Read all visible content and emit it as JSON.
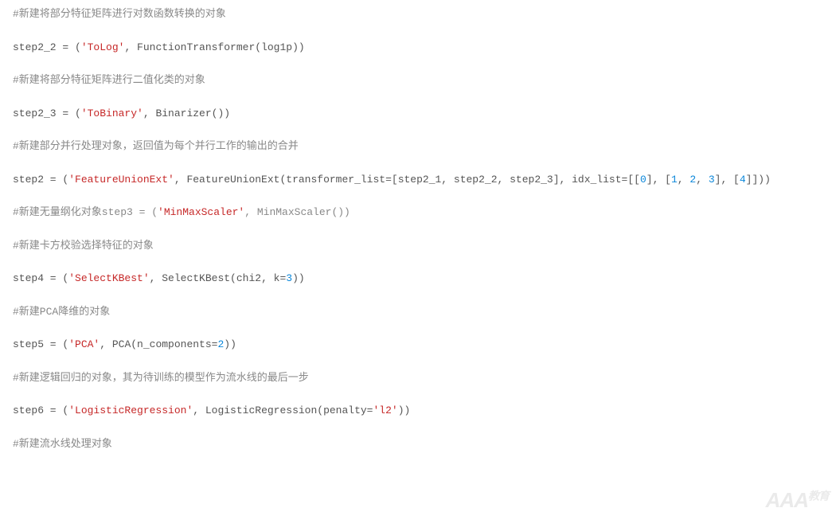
{
  "lines": [
    [
      {
        "class": "comment",
        "text": "#新建将部分特征矩阵进行对数函数转换的对象"
      }
    ],
    [
      {
        "class": "plain",
        "text": "step2_2 = ("
      },
      {
        "class": "string",
        "text": "'ToLog'"
      },
      {
        "class": "plain",
        "text": ", FunctionTransformer(log1p))"
      }
    ],
    [
      {
        "class": "comment",
        "text": "#新建将部分特征矩阵进行二值化类的对象"
      }
    ],
    [
      {
        "class": "plain",
        "text": "step2_3 = ("
      },
      {
        "class": "string",
        "text": "'ToBinary'"
      },
      {
        "class": "plain",
        "text": ", Binarizer())"
      }
    ],
    [
      {
        "class": "comment",
        "text": "#新建部分并行处理对象，返回值为每个并行工作的输出的合并"
      }
    ],
    [
      {
        "class": "plain",
        "text": "step2 = ("
      },
      {
        "class": "string",
        "text": "'FeatureUnionExt'"
      },
      {
        "class": "plain",
        "text": ", FeatureUnionExt(transformer_list=[step2_1, step2_2, step2_3], idx_list=[["
      },
      {
        "class": "number",
        "text": "0"
      },
      {
        "class": "plain",
        "text": "], ["
      },
      {
        "class": "number",
        "text": "1"
      },
      {
        "class": "plain",
        "text": ", "
      },
      {
        "class": "number",
        "text": "2"
      },
      {
        "class": "plain",
        "text": ", "
      },
      {
        "class": "number",
        "text": "3"
      },
      {
        "class": "plain",
        "text": "], ["
      },
      {
        "class": "number",
        "text": "4"
      },
      {
        "class": "plain",
        "text": "]]))"
      }
    ],
    [
      {
        "class": "comment",
        "text": "#新建无量纲化对象step3 = ("
      },
      {
        "class": "string",
        "text": "'MinMaxScaler'"
      },
      {
        "class": "comment",
        "text": ", MinMaxScaler())"
      }
    ],
    [
      {
        "class": "comment",
        "text": "#新建卡方校验选择特征的对象"
      }
    ],
    [
      {
        "class": "plain",
        "text": "step4 = ("
      },
      {
        "class": "string",
        "text": "'SelectKBest'"
      },
      {
        "class": "plain",
        "text": ", SelectKBest(chi2, k="
      },
      {
        "class": "number",
        "text": "3"
      },
      {
        "class": "plain",
        "text": "))"
      }
    ],
    [
      {
        "class": "comment",
        "text": "#新建PCA降维的对象"
      }
    ],
    [
      {
        "class": "plain",
        "text": "step5 = ("
      },
      {
        "class": "string",
        "text": "'PCA'"
      },
      {
        "class": "plain",
        "text": ", PCA(n_components="
      },
      {
        "class": "number",
        "text": "2"
      },
      {
        "class": "plain",
        "text": "))"
      }
    ],
    [
      {
        "class": "comment",
        "text": "#新建逻辑回归的对象，其为待训练的模型作为流水线的最后一步"
      }
    ],
    [
      {
        "class": "plain",
        "text": "step6 = ("
      },
      {
        "class": "string",
        "text": "'LogisticRegression'"
      },
      {
        "class": "plain",
        "text": ", LogisticRegression(penalty="
      },
      {
        "class": "string",
        "text": "'l2'"
      },
      {
        "class": "plain",
        "text": "))"
      }
    ],
    [
      {
        "class": "comment",
        "text": "#新建流水线处理对象"
      }
    ]
  ],
  "watermark": {
    "main": "AAA",
    "suffix": "教育"
  }
}
